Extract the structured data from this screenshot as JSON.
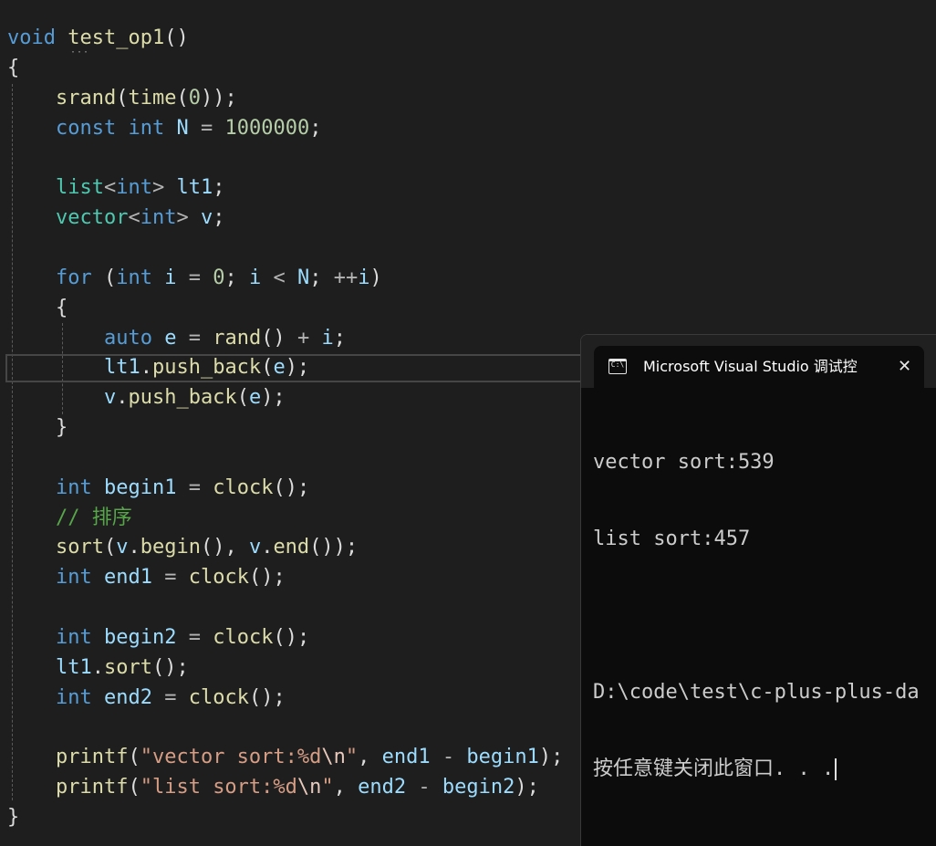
{
  "editor": {
    "lines": [
      {
        "tokens": [
          {
            "t": "void",
            "c": "kw"
          },
          {
            "t": " ",
            "c": "pn"
          },
          {
            "t": "test_op1",
            "c": "fn"
          },
          {
            "t": "()",
            "c": "pn"
          }
        ]
      },
      {
        "tokens": [
          {
            "t": "{",
            "c": "pn"
          }
        ]
      },
      {
        "tokens": [
          {
            "t": "    ",
            "c": "pn"
          },
          {
            "t": "srand",
            "c": "fn"
          },
          {
            "t": "(",
            "c": "pn"
          },
          {
            "t": "time",
            "c": "fn"
          },
          {
            "t": "(",
            "c": "pn"
          },
          {
            "t": "0",
            "c": "num"
          },
          {
            "t": "));",
            "c": "pn"
          }
        ]
      },
      {
        "tokens": [
          {
            "t": "    ",
            "c": "pn"
          },
          {
            "t": "const",
            "c": "kw"
          },
          {
            "t": " ",
            "c": "pn"
          },
          {
            "t": "int",
            "c": "kw"
          },
          {
            "t": " ",
            "c": "pn"
          },
          {
            "t": "N",
            "c": "var"
          },
          {
            "t": " = ",
            "c": "op"
          },
          {
            "t": "1000000",
            "c": "num"
          },
          {
            "t": ";",
            "c": "pn"
          }
        ]
      },
      {
        "tokens": []
      },
      {
        "tokens": [
          {
            "t": "    ",
            "c": "pn"
          },
          {
            "t": "list",
            "c": "ty"
          },
          {
            "t": "<",
            "c": "op"
          },
          {
            "t": "int",
            "c": "kw"
          },
          {
            "t": ">",
            "c": "op"
          },
          {
            "t": " ",
            "c": "pn"
          },
          {
            "t": "lt1",
            "c": "var"
          },
          {
            "t": ";",
            "c": "pn"
          }
        ]
      },
      {
        "tokens": [
          {
            "t": "    ",
            "c": "pn"
          },
          {
            "t": "vector",
            "c": "ty"
          },
          {
            "t": "<",
            "c": "op"
          },
          {
            "t": "int",
            "c": "kw"
          },
          {
            "t": ">",
            "c": "op"
          },
          {
            "t": " ",
            "c": "pn"
          },
          {
            "t": "v",
            "c": "var"
          },
          {
            "t": ";",
            "c": "pn"
          }
        ]
      },
      {
        "tokens": []
      },
      {
        "tokens": [
          {
            "t": "    ",
            "c": "pn"
          },
          {
            "t": "for",
            "c": "kw"
          },
          {
            "t": " (",
            "c": "pn"
          },
          {
            "t": "int",
            "c": "kw"
          },
          {
            "t": " ",
            "c": "pn"
          },
          {
            "t": "i",
            "c": "var"
          },
          {
            "t": " = ",
            "c": "op"
          },
          {
            "t": "0",
            "c": "num"
          },
          {
            "t": "; ",
            "c": "pn"
          },
          {
            "t": "i",
            "c": "var"
          },
          {
            "t": " < ",
            "c": "op"
          },
          {
            "t": "N",
            "c": "var"
          },
          {
            "t": "; ",
            "c": "pn"
          },
          {
            "t": "++",
            "c": "op"
          },
          {
            "t": "i",
            "c": "var"
          },
          {
            "t": ")",
            "c": "pn"
          }
        ]
      },
      {
        "tokens": [
          {
            "t": "    {",
            "c": "pn"
          }
        ]
      },
      {
        "tokens": [
          {
            "t": "        ",
            "c": "pn"
          },
          {
            "t": "auto",
            "c": "kw"
          },
          {
            "t": " ",
            "c": "pn"
          },
          {
            "t": "e",
            "c": "var"
          },
          {
            "t": " = ",
            "c": "op"
          },
          {
            "t": "rand",
            "c": "fn"
          },
          {
            "t": "() ",
            "c": "pn"
          },
          {
            "t": "+",
            "c": "op"
          },
          {
            "t": " ",
            "c": "pn"
          },
          {
            "t": "i",
            "c": "var"
          },
          {
            "t": ";",
            "c": "pn"
          }
        ]
      },
      {
        "tokens": [
          {
            "t": "        ",
            "c": "pn"
          },
          {
            "t": "lt1",
            "c": "var"
          },
          {
            "t": ".",
            "c": "pn"
          },
          {
            "t": "push_back",
            "c": "fn"
          },
          {
            "t": "(",
            "c": "pn"
          },
          {
            "t": "e",
            "c": "var"
          },
          {
            "t": ");",
            "c": "pn"
          }
        ]
      },
      {
        "tokens": [
          {
            "t": "        ",
            "c": "pn"
          },
          {
            "t": "v",
            "c": "var"
          },
          {
            "t": ".",
            "c": "pn"
          },
          {
            "t": "push_back",
            "c": "fn"
          },
          {
            "t": "(",
            "c": "pn"
          },
          {
            "t": "e",
            "c": "var"
          },
          {
            "t": ");",
            "c": "pn"
          }
        ]
      },
      {
        "tokens": [
          {
            "t": "    }",
            "c": "pn"
          }
        ]
      },
      {
        "tokens": []
      },
      {
        "tokens": [
          {
            "t": "    ",
            "c": "pn"
          },
          {
            "t": "int",
            "c": "kw"
          },
          {
            "t": " ",
            "c": "pn"
          },
          {
            "t": "begin1",
            "c": "var"
          },
          {
            "t": " = ",
            "c": "op"
          },
          {
            "t": "clock",
            "c": "fn"
          },
          {
            "t": "();",
            "c": "pn"
          }
        ]
      },
      {
        "tokens": [
          {
            "t": "    ",
            "c": "pn"
          },
          {
            "t": "// 排序",
            "c": "cmt"
          }
        ]
      },
      {
        "tokens": [
          {
            "t": "    ",
            "c": "pn"
          },
          {
            "t": "sort",
            "c": "fn"
          },
          {
            "t": "(",
            "c": "pn"
          },
          {
            "t": "v",
            "c": "var"
          },
          {
            "t": ".",
            "c": "pn"
          },
          {
            "t": "begin",
            "c": "fn"
          },
          {
            "t": "(), ",
            "c": "pn"
          },
          {
            "t": "v",
            "c": "var"
          },
          {
            "t": ".",
            "c": "pn"
          },
          {
            "t": "end",
            "c": "fn"
          },
          {
            "t": "());",
            "c": "pn"
          }
        ]
      },
      {
        "tokens": [
          {
            "t": "    ",
            "c": "pn"
          },
          {
            "t": "int",
            "c": "kw"
          },
          {
            "t": " ",
            "c": "pn"
          },
          {
            "t": "end1",
            "c": "var"
          },
          {
            "t": " = ",
            "c": "op"
          },
          {
            "t": "clock",
            "c": "fn"
          },
          {
            "t": "();",
            "c": "pn"
          }
        ]
      },
      {
        "tokens": []
      },
      {
        "tokens": [
          {
            "t": "    ",
            "c": "pn"
          },
          {
            "t": "int",
            "c": "kw"
          },
          {
            "t": " ",
            "c": "pn"
          },
          {
            "t": "begin2",
            "c": "var"
          },
          {
            "t": " = ",
            "c": "op"
          },
          {
            "t": "clock",
            "c": "fn"
          },
          {
            "t": "();",
            "c": "pn"
          }
        ]
      },
      {
        "tokens": [
          {
            "t": "    ",
            "c": "pn"
          },
          {
            "t": "lt1",
            "c": "var"
          },
          {
            "t": ".",
            "c": "pn"
          },
          {
            "t": "sort",
            "c": "fn"
          },
          {
            "t": "();",
            "c": "pn"
          }
        ]
      },
      {
        "tokens": [
          {
            "t": "    ",
            "c": "pn"
          },
          {
            "t": "int",
            "c": "kw"
          },
          {
            "t": " ",
            "c": "pn"
          },
          {
            "t": "end2",
            "c": "var"
          },
          {
            "t": " = ",
            "c": "op"
          },
          {
            "t": "clock",
            "c": "fn"
          },
          {
            "t": "();",
            "c": "pn"
          }
        ]
      },
      {
        "tokens": []
      },
      {
        "tokens": [
          {
            "t": "    ",
            "c": "pn"
          },
          {
            "t": "printf",
            "c": "fn"
          },
          {
            "t": "(",
            "c": "pn"
          },
          {
            "t": "\"vector sort:%d",
            "c": "str"
          },
          {
            "t": "\\n",
            "c": "esc"
          },
          {
            "t": "\"",
            "c": "str"
          },
          {
            "t": ", ",
            "c": "pn"
          },
          {
            "t": "end1",
            "c": "var"
          },
          {
            "t": " - ",
            "c": "op"
          },
          {
            "t": "begin1",
            "c": "var"
          },
          {
            "t": ");",
            "c": "pn"
          }
        ]
      },
      {
        "tokens": [
          {
            "t": "    ",
            "c": "pn"
          },
          {
            "t": "printf",
            "c": "fn"
          },
          {
            "t": "(",
            "c": "pn"
          },
          {
            "t": "\"list sort:%d",
            "c": "str"
          },
          {
            "t": "\\n",
            "c": "esc"
          },
          {
            "t": "\"",
            "c": "str"
          },
          {
            "t": ", ",
            "c": "pn"
          },
          {
            "t": "end2",
            "c": "var"
          },
          {
            "t": " - ",
            "c": "op"
          },
          {
            "t": "begin2",
            "c": "var"
          },
          {
            "t": ");",
            "c": "pn"
          }
        ]
      },
      {
        "tokens": [
          {
            "t": "}",
            "c": "pn"
          }
        ]
      }
    ],
    "colors": {
      "background": "#1e1e1e",
      "keyword": "#569cd6",
      "type": "#4ec9b0",
      "function": "#dcdcaa",
      "variable": "#9cdcfe",
      "number": "#b5cea8",
      "string": "#d69d85",
      "comment": "#57a64a"
    }
  },
  "console": {
    "icon": "terminal-icon",
    "tab_title": "Microsoft Visual Studio 调试控",
    "close_glyph": "✕",
    "output": [
      "vector sort:539",
      "list sort:457",
      "",
      "D:\\code\\test\\c-plus-plus-da",
      "按任意键关闭此窗口. . ."
    ]
  }
}
